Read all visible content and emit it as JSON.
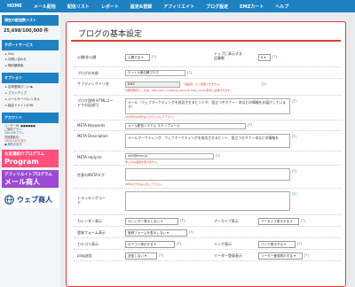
{
  "nav": [
    "HOME",
    "メール配信",
    "配信リスト",
    "レポート",
    "設定&登録",
    "アフィリエイト",
    "ブログ設定",
    "EMZカート",
    "ヘルプ"
  ],
  "sidebar": {
    "points_head": "現在の配信数リスト",
    "points_count": "25,698/100,000 件",
    "support_head": "サポートサービス",
    "support_items": [
      "FAQ",
      "お問い合わせ",
      "規約類検索"
    ],
    "option_head": "オプション",
    "option_items": [
      "名刺登録ｵﾌﾟｼｮﾝ ▶",
      "ブランアップ",
      "メールサーバ/レンタル",
      "独自ドメイン/URL"
    ],
    "account_head": "アカウント",
    "account_lines": [
      "ユーザーID: ●●●●●●",
      "ご契約プラン：",
      "100,000プラン",
      "次回更新日：",
      "2020/12/31まで"
    ],
    "account_link": "● 解約手続き",
    "banners": {
      "program_top": "お友達紹介プログラム",
      "program_big": "Program",
      "affiliate_top": "アフィリエイトプログラム",
      "affiliate_big": "メール商人",
      "logo": "ウェブ商人"
    }
  },
  "page": {
    "title": "ブログの基本設定",
    "help": "[?]",
    "fields": {
      "public": {
        "label": "公開/非公開",
        "value": "公開する"
      },
      "top_posts": {
        "label": "トップに表示する記事数",
        "value": "6"
      },
      "blog_name": {
        "label": "ブログの名前",
        "value": "ネット&実店舗ブログ"
      },
      "subdir": {
        "label": "サブディレクトリ名",
        "value": "EMZ",
        "note": "一度設定したら変更できません。",
        "note2": "半角英数字と‐_のみ。http://abc.com/blog_name/の blog_name 部分に反映されます。"
      },
      "description": {
        "label": "ブログ説明 HTMLコードでの記述可",
        "value": "メール・ウェブマーケティングを成功させるヒントや、役立つセミナー・本などの情報をお届けしています！",
        "note": "250字の以内かな入力で入力して下さい。"
      },
      "keywords": {
        "label": "META Keywords",
        "value": "メール配信システム ステップメール"
      },
      "meta_desc": {
        "label": "META Description",
        "value": "メールマーケティング、ウェブマーケティングを成功させるヒント、役立つセミナー本などの情報を"
      },
      "reply_to": {
        "label": "META reply-to",
        "value": "info@emz.jp",
        "note": "未入力は返答を受けません。"
      },
      "tags": {
        "label": "任意のMETAタグ",
        "value": "",
        "note": "METAタグのみ入力して下さい。"
      },
      "tracking": {
        "label": "トラッキングコード",
        "value": ""
      },
      "calendar": {
        "label": "カレンダー表示",
        "value": "カレンダー表示しない"
      },
      "archive": {
        "label": "アーカイブ表示",
        "value": "アーカイブ表示する"
      },
      "newsletter": {
        "label": "登録フォーム表示",
        "value": "登録フォームを表示しない"
      },
      "category": {
        "label": "カテゴリ表示",
        "value": "カテゴリ表示する"
      },
      "link": {
        "label": "リンク表示",
        "value": "リンク表示する"
      },
      "ping": {
        "label": "ping送信",
        "value": "送信しない"
      },
      "reader": {
        "label": "リーダー登録表示",
        "value": "リーダー登録表示する"
      }
    }
  }
}
